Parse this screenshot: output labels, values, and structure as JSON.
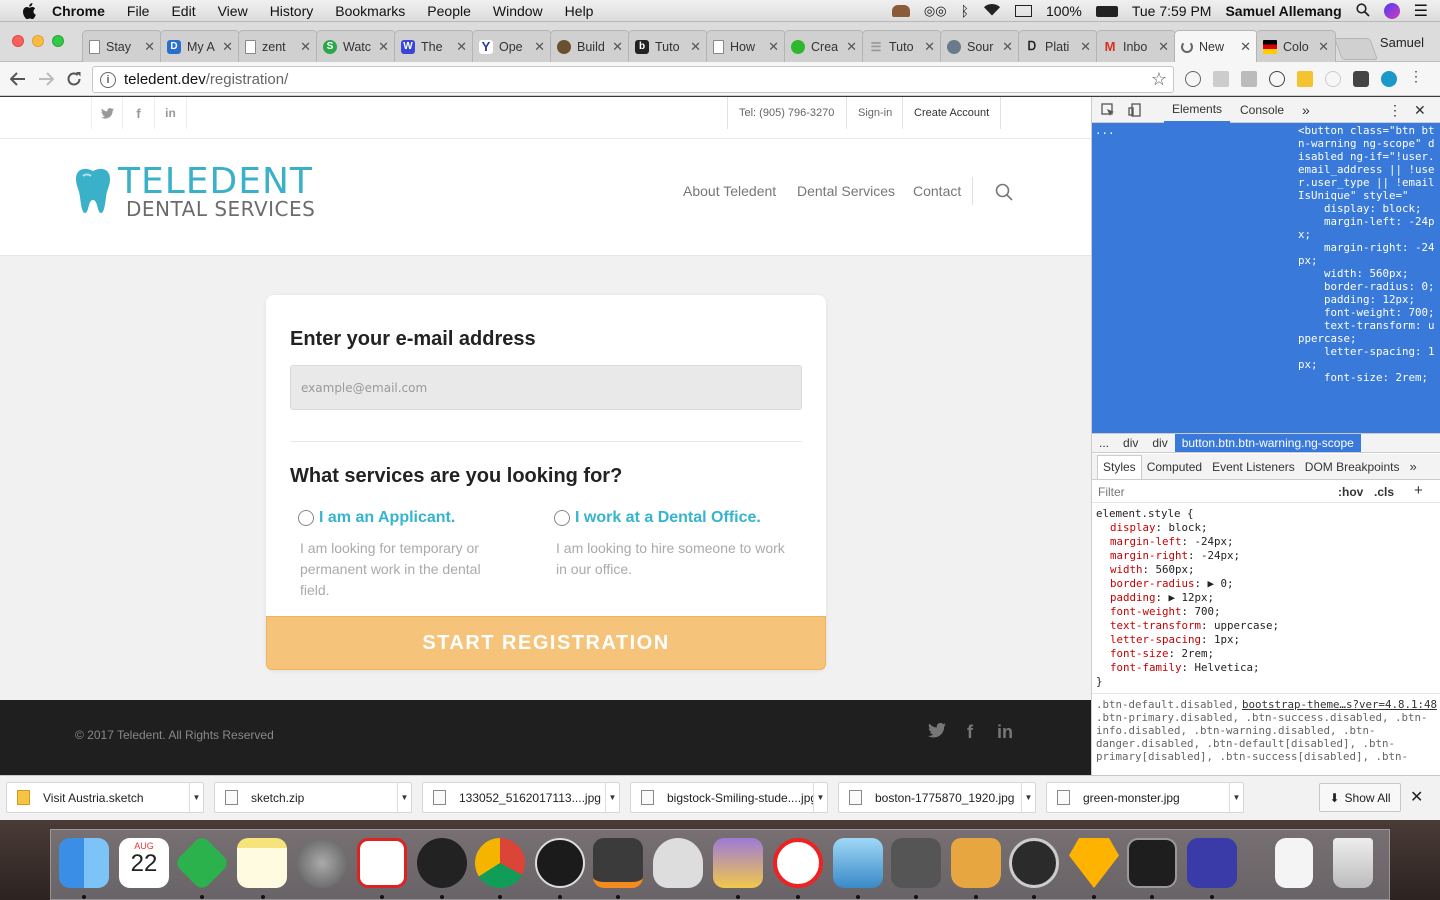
{
  "menubar": {
    "app": "Chrome",
    "items": [
      "File",
      "Edit",
      "View",
      "History",
      "Bookmarks",
      "People",
      "Window",
      "Help"
    ],
    "battery": "100%",
    "clock": "Tue 7:59 PM",
    "user": "Samuel Allemang"
  },
  "browser": {
    "tabs": [
      {
        "title": "Stay",
        "icon": "page-icon"
      },
      {
        "title": "My A",
        "icon": "d-icon"
      },
      {
        "title": "zent",
        "icon": "page-icon"
      },
      {
        "title": "Watc",
        "icon": "s-icon"
      },
      {
        "title": "The",
        "icon": "w-icon"
      },
      {
        "title": "Ope",
        "icon": "y-icon"
      },
      {
        "title": "Build",
        "icon": "character-icon"
      },
      {
        "title": "Tuto",
        "icon": "b-icon"
      },
      {
        "title": "How",
        "icon": "page-icon"
      },
      {
        "title": "Crea",
        "icon": "android-icon"
      },
      {
        "title": "Tuto",
        "icon": "lines-icon"
      },
      {
        "title": "Sour",
        "icon": "sourcetree-icon"
      },
      {
        "title": "Plati",
        "icon": "dg-icon"
      },
      {
        "title": "Inbo",
        "icon": "gmail-icon"
      },
      {
        "title": "New",
        "icon": "loading-icon",
        "active": true
      },
      {
        "title": "Colo",
        "icon": "flag-icon"
      }
    ],
    "profile": "Samuel",
    "url_host": "teledent.dev",
    "url_path": "/registration/"
  },
  "site": {
    "phone": "Tel: (905) 796-3270",
    "signin": "Sign-in",
    "create_account": "Create Account",
    "logo_top": "TELEDENT",
    "logo_bottom": "DENTAL SERVICES",
    "nav": [
      "About Teledent",
      "Dental Services",
      "Contact"
    ],
    "form": {
      "email_heading": "Enter your e-mail address",
      "email_placeholder": "example@email.com",
      "email_value": "",
      "services_heading": "What services are you looking for?",
      "option1_label": "I am an Applicant.",
      "option1_desc": "I am looking for temporary or permanent work in the dental field.",
      "option2_label": "I work at a Dental Office.",
      "option2_desc": "I am looking to hire someone to work in our office.",
      "submit": "Start Registration"
    },
    "footer": "© 2017 Teledent. All Rights Reserved",
    "accent": "#35b4d0",
    "button_color": "#f5c47a"
  },
  "devtools": {
    "tabs": [
      "Elements",
      "Console"
    ],
    "dom_ellipsis": "...",
    "dom_code": "<button class=\"btn btn-warning ng-scope\" disabled ng-if=\"!user.email_address || !user.user_type || !emailIsUnique\" style=\"\n    display: block;\n    margin-left: -24px;\n    margin-right: -24px;\n    width: 560px;\n    border-radius: 0;\n    padding: 12px;\n    font-weight: 700;\n    text-transform: uppercase;\n    letter-spacing: 1px;\n    font-size: 2rem;",
    "breadcrumbs": [
      "...",
      "div",
      "div",
      "button.btn.btn-warning.ng-scope"
    ],
    "subtabs": [
      "Styles",
      "Computed",
      "Event Listeners",
      "DOM Breakpoints"
    ],
    "filter": "Filter",
    "hov": ":hov",
    "cls": ".cls",
    "selector": "element.style {",
    "props": [
      {
        "p": "display",
        "v": "block;"
      },
      {
        "p": "margin-left",
        "v": "-24px;"
      },
      {
        "p": "margin-right",
        "v": "-24px;"
      },
      {
        "p": "width",
        "v": "560px;"
      },
      {
        "p": "border-radius",
        "v": "▶ 0;"
      },
      {
        "p": "padding",
        "v": "▶ 12px;"
      },
      {
        "p": "font-weight",
        "v": "700;"
      },
      {
        "p": "text-transform",
        "v": "uppercase;"
      },
      {
        "p": "letter-spacing",
        "v": "1px;"
      },
      {
        "p": "font-size",
        "v": "2rem;"
      },
      {
        "p": "font-family",
        "v": "Helvetica;"
      }
    ],
    "close_brace": "}",
    "rule2_source": "bootstrap-theme…s?ver=4.8.1:48",
    "rule2_text": ".btn-default.disabled, .btn-primary.disabled, .btn-success.disabled, .btn-info.disabled, .btn-warning.disabled, .btn-danger.disabled, .btn-default[disabled], .btn-primary[disabled], .btn-success[disabled], .btn-"
  },
  "downloads": {
    "items": [
      "Visit Austria.sketch",
      "sketch.zip",
      "133052_5162017113....jpg",
      "bigstock-Smiling-stude....jpg",
      "boston-1775870_1920.jpg",
      "green-monster.jpg"
    ],
    "show_all": "Show All"
  },
  "dock": {
    "calendar_month": "AUG",
    "calendar_day": "22"
  }
}
